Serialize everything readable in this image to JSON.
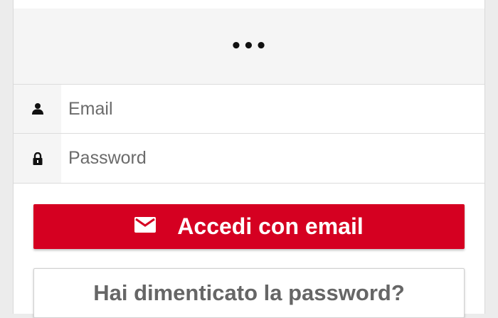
{
  "header": {
    "more_label": "•••"
  },
  "form": {
    "email": {
      "placeholder": "Email",
      "value": "",
      "icon": "user-icon"
    },
    "password": {
      "placeholder": "Password",
      "value": "",
      "icon": "lock-icon"
    }
  },
  "actions": {
    "login_email_label": "Accedi con email",
    "login_email_icon": "envelope-icon",
    "forgot_password_label": "Hai dimenticato la password?"
  },
  "colors": {
    "primary": "#d50021",
    "background": "#ececec",
    "panel": "#f5f5f5",
    "border": "#dcdcdc",
    "muted_text": "#666666"
  }
}
